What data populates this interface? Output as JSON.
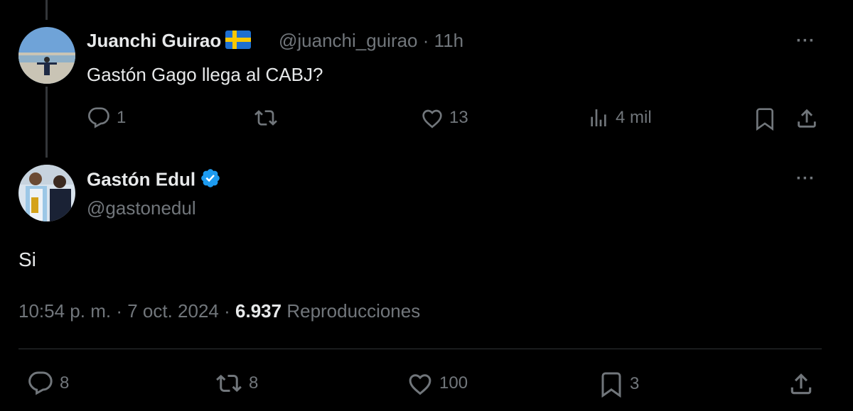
{
  "reply": {
    "author_name": "Juanchi Guirao",
    "flag_icon": "sweden-flag-icon",
    "handle": "@juanchi_guirao",
    "separator": "·",
    "time": "11h",
    "text": "Gastón Gago llega al CABJ?",
    "actions": {
      "replies": "1",
      "reposts": "",
      "likes": "13",
      "views": "4 mil"
    }
  },
  "main": {
    "author_name": "Gastón Edul",
    "verified_icon": "verified-badge-icon",
    "handle": "@gastonedul",
    "text": "Si",
    "time": "10:54 p. m.",
    "sep1": "·",
    "date": "7 oct. 2024",
    "sep2": "·",
    "views_count": "6.937",
    "views_label": "Reproducciones",
    "actions": {
      "replies": "8",
      "reposts": "8",
      "likes": "100",
      "bookmarks": "3"
    }
  },
  "colors": {
    "background": "#000000",
    "text": "#e7e9ea",
    "muted": "#71767b",
    "verified": "#1d9bf0",
    "divider": "#2f3336"
  }
}
